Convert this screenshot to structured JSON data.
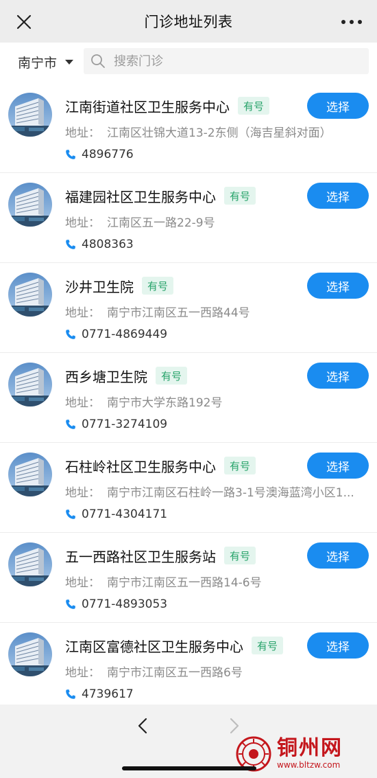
{
  "navbar": {
    "title": "门诊地址列表"
  },
  "search": {
    "city": "南宁市",
    "placeholder": "搜索门诊"
  },
  "labels": {
    "address_prefix": "地址：",
    "select_button": "选择"
  },
  "colors": {
    "accent": "#1a8cf0",
    "badge_bg": "#e4f5ee",
    "badge_text": "#27a36a"
  },
  "clinics": [
    {
      "name": "江南街道社区卫生服务中心",
      "badge": "有号",
      "address": "江南区壮锦大道13-2东侧（海吉星斜对面）",
      "phone": "4896776"
    },
    {
      "name": "福建园社区卫生服务中心",
      "badge": "有号",
      "address": "江南区五一路22-9号",
      "phone": "4808363"
    },
    {
      "name": "沙井卫生院",
      "badge": "有号",
      "address": "南宁市江南区五一西路44号",
      "phone": "0771-4869449"
    },
    {
      "name": "西乡塘卫生院",
      "badge": "有号",
      "address": "南宁市大学东路192号",
      "phone": "0771-3274109"
    },
    {
      "name": "石柱岭社区卫生服务中心",
      "badge": "有号",
      "address": "南宁市江南区石柱岭一路3-1号澳海蓝湾小区1...",
      "phone": "0771-4304171"
    },
    {
      "name": "五一西路社区卫生服务站",
      "badge": "有号",
      "address": "南宁市江南区五一西路14-6号",
      "phone": "0771-4893053"
    },
    {
      "name": "江南区富德社区卫生服务中心",
      "badge": "有号",
      "address": "南宁市江南区五一西路6号",
      "phone": "4739617"
    }
  ],
  "watermark": {
    "title": "铜州网",
    "url": "www.bltzw.com"
  }
}
